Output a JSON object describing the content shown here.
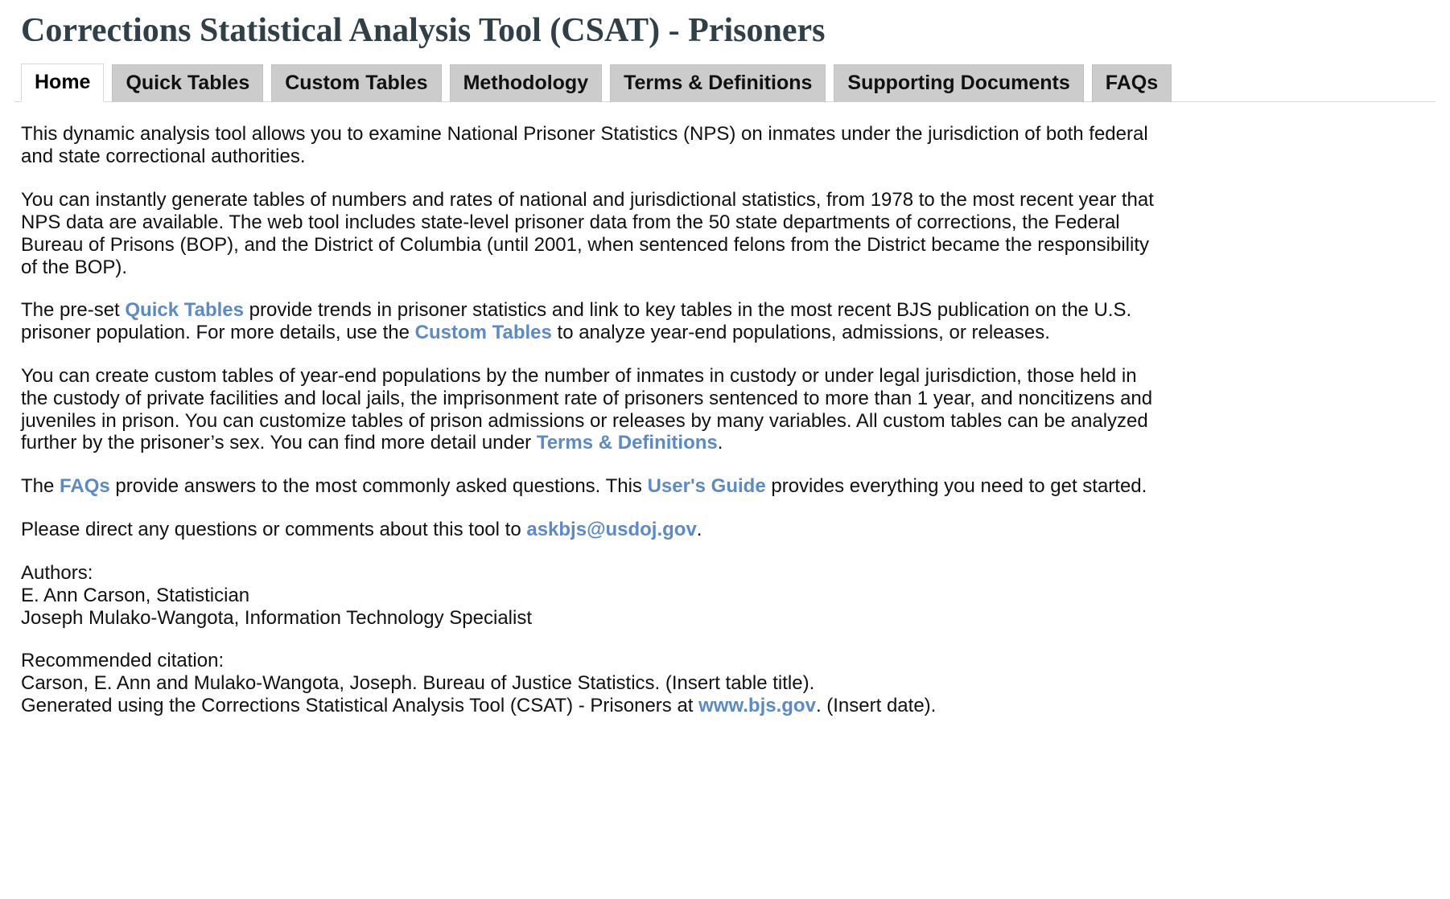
{
  "header": {
    "title": "Corrections Statistical Analysis Tool (CSAT) - Prisoners"
  },
  "tabs": [
    {
      "id": "home",
      "label": "Home",
      "active": true
    },
    {
      "id": "quick",
      "label": "Quick Tables",
      "active": false
    },
    {
      "id": "custom",
      "label": "Custom Tables",
      "active": false
    },
    {
      "id": "method",
      "label": "Methodology",
      "active": false
    },
    {
      "id": "terms",
      "label": "Terms & Definitions",
      "active": false
    },
    {
      "id": "docs",
      "label": "Supporting Documents",
      "active": false
    },
    {
      "id": "faqs",
      "label": "FAQs",
      "active": false
    }
  ],
  "intro": {
    "p1": "This dynamic analysis tool allows you to examine National Prisoner Statistics (NPS) on inmates under the jurisdiction of both federal and state correctional authorities.",
    "p2": "You can instantly generate tables of numbers and rates of national and jurisdictional statistics, from 1978 to the most recent year that NPS data are available. The web tool includes state-level prisoner data from the 50 state departments of corrections, the Federal Bureau of Prisons (BOP), and the District of Columbia (until 2001, when sentenced felons from the District became the responsibility of the BOP).",
    "p3_a": "The pre-set ",
    "p3_link1": "Quick Tables",
    "p3_b": " provide trends in prisoner statistics and link to key tables in the most recent BJS publication on the U.S. prisoner population. For more details, use the ",
    "p3_link2": "Custom Tables",
    "p3_c": " to analyze year-end populations, admissions, or releases.",
    "p4_a": "You can create custom tables of year-end populations by the number of inmates in custody or under legal jurisdiction, those held in the custody of private facilities and local jails, the imprisonment rate of prisoners sentenced to more than 1 year, and noncitizens and juveniles in prison. You can customize tables of prison admissions or releases by many variables. All custom tables can be analyzed further by the prisoner’s sex. You can find more detail under ",
    "p4_link": "Terms & Definitions",
    "p4_b": ".",
    "p5_a": "The ",
    "p5_link1": "FAQs",
    "p5_b": " provide answers to the most commonly asked questions. This ",
    "p5_link2": "User's Guide",
    "p5_c": " provides everything you need to get started.",
    "p6_a": "Please direct any questions or comments about this tool to ",
    "p6_email": "askbjs@usdoj.gov",
    "p6_b": "."
  },
  "authors": {
    "heading": "Authors:",
    "line1": "E. Ann Carson, Statistician",
    "line2": "Joseph Mulako-Wangota, Information Technology Specialist"
  },
  "citation": {
    "heading": "Recommended citation:",
    "line1": "Carson, E. Ann and Mulako-Wangota, Joseph. Bureau of Justice Statistics. (Insert table title).",
    "line2_a": "Generated using the Corrections Statistical Analysis Tool (CSAT) - Prisoners at ",
    "line2_link": "www.bjs.gov",
    "line2_b": ". (Insert date)."
  },
  "colors": {
    "title": "#2f4049",
    "link": "#5b8ac9",
    "tab_inactive_bg": "#cccccc",
    "tab_active_bg": "#ffffff",
    "text": "#111111"
  }
}
